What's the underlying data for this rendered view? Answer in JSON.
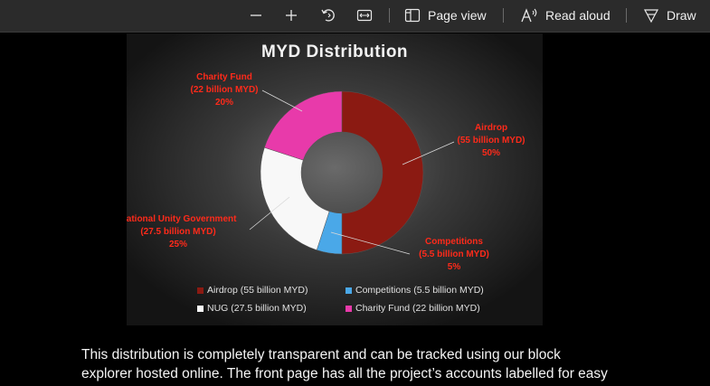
{
  "toolbar": {
    "minus_icon": "minus-icon",
    "plus_icon": "plus-icon",
    "rotate_icon": "rotate-icon",
    "fit_icon": "fit-width-icon",
    "page_view_label": "Page view",
    "read_aloud_label": "Read aloud",
    "draw_label": "Draw"
  },
  "chart": {
    "title": "MYD Distribution",
    "callouts": {
      "airdrop": [
        "Airdrop",
        "(55 billion MYD)",
        "50%"
      ],
      "competitions": [
        "Competitions",
        "(5.5 billion MYD)",
        "5%"
      ],
      "nug": [
        "National Unity Government",
        "(27.5 billion MYD)",
        "25%"
      ],
      "charity": [
        "Charity Fund",
        "(22 billion MYD)",
        "20%"
      ]
    },
    "legend": [
      "Airdrop (55 billion MYD)",
      "Competitions (5.5 billion MYD)",
      "NUG (27.5 billion MYD)",
      "Charity Fund (22 billion MYD)"
    ]
  },
  "chart_data": {
    "type": "pie",
    "title": "MYD Distribution",
    "categories": [
      "Airdrop",
      "Competitions",
      "National Unity Government",
      "Charity Fund"
    ],
    "values": [
      55,
      5.5,
      27.5,
      22
    ],
    "percent": [
      50,
      5,
      25,
      20
    ],
    "units": "billion MYD",
    "donut": true,
    "colors": [
      "#8b1a12",
      "#4aa8e8",
      "#f8f8f8",
      "#e83aaa"
    ],
    "legend_position": "bottom"
  },
  "body": {
    "line1": "This distribution is completely transparent and can be tracked using our block",
    "line2": "explorer hosted online. The front page has all the project’s accounts labelled for easy"
  }
}
